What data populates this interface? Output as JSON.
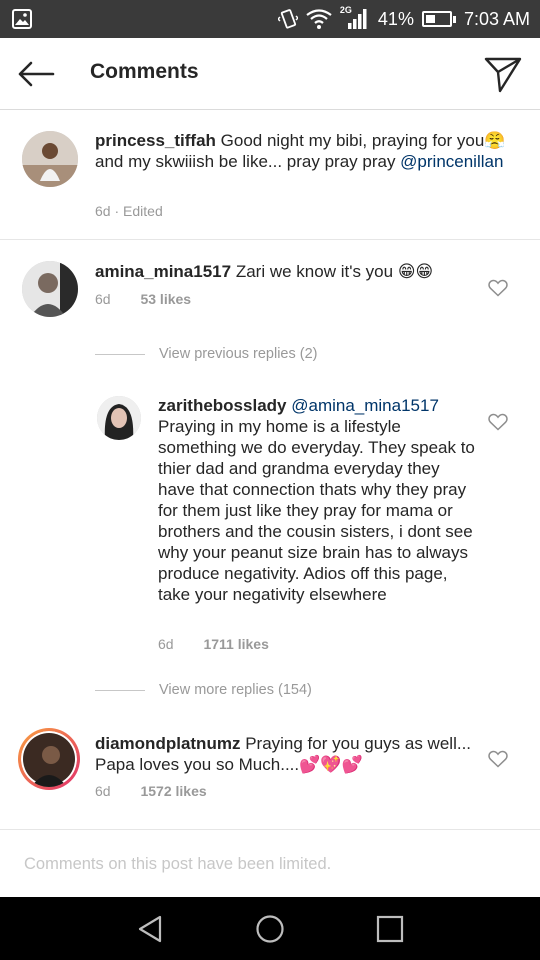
{
  "status_bar": {
    "network": "2G",
    "battery": "41%",
    "battery_level": 0.41,
    "time": "7:03 AM"
  },
  "header": {
    "title": "Comments"
  },
  "comments": [
    {
      "username": "princess_tiffah",
      "text_before": "Good night my bibi, praying for you",
      "emoji": "😤",
      "text_after": " and my skwiiish be like... pray pray pray ",
      "mention": "@princenillan",
      "time": "6d",
      "extra": "Edited"
    },
    {
      "username": "amina_mina1517",
      "text": "Zari we know it's you",
      "emoji": "😁😁",
      "time": "6d",
      "likes": "53 likes"
    },
    {
      "username": "zarithebosslady",
      "mention": "@amina_mina1517",
      "text": "Praying in my home is a lifestyle something we do everyday. They speak to thier dad and grandma everyday they have that connection thats why they pray for them just like they pray for mama or brothers and the cousin sisters, i dont see why your peanut size brain has to always produce negativity. Adios off this page, take your negativity elsewhere",
      "time": "6d",
      "likes": "1711 likes"
    },
    {
      "username": "diamondplatnumz",
      "text": "Praying for you guys as well... Papa loves you so Much....",
      "emoji": "💕💖💕",
      "time": "6d",
      "likes": "1572 likes"
    }
  ],
  "view_previous_replies": "View previous replies (2)",
  "view_more_replies": "View more replies (154)",
  "footer_note": "Comments on this post have been limited."
}
